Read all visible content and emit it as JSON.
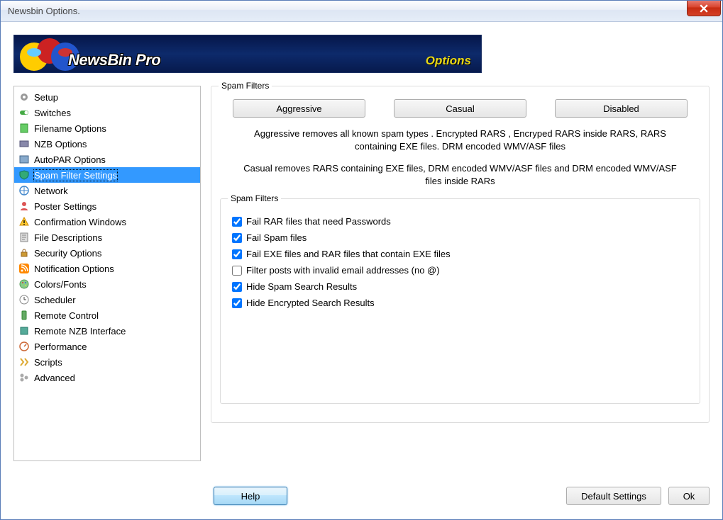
{
  "window": {
    "title": "Newsbin Options."
  },
  "banner": {
    "brand": "NewsBin Pro",
    "right": "Options"
  },
  "sidebar": {
    "items": [
      {
        "label": "Setup",
        "icon": "gear-icon"
      },
      {
        "label": "Switches",
        "icon": "switch-icon"
      },
      {
        "label": "Filename Options",
        "icon": "filename-icon"
      },
      {
        "label": "NZB Options",
        "icon": "nzb-icon"
      },
      {
        "label": "AutoPAR Options",
        "icon": "autopar-icon"
      },
      {
        "label": "Spam Filter Settings",
        "icon": "shield-icon",
        "selected": true
      },
      {
        "label": "Network",
        "icon": "network-icon"
      },
      {
        "label": "Poster Settings",
        "icon": "poster-icon"
      },
      {
        "label": "Confirmation Windows",
        "icon": "warning-icon"
      },
      {
        "label": "File Descriptions",
        "icon": "file-icon"
      },
      {
        "label": "Security Options",
        "icon": "lock-icon"
      },
      {
        "label": "Notification Options",
        "icon": "rss-icon"
      },
      {
        "label": "Colors/Fonts",
        "icon": "palette-icon"
      },
      {
        "label": "Scheduler",
        "icon": "clock-icon"
      },
      {
        "label": "Remote Control",
        "icon": "remote-icon"
      },
      {
        "label": "Remote NZB Interface",
        "icon": "remote-nzb-icon"
      },
      {
        "label": "Performance",
        "icon": "performance-icon"
      },
      {
        "label": "Scripts",
        "icon": "script-icon"
      },
      {
        "label": "Advanced",
        "icon": "advanced-icon"
      }
    ]
  },
  "main": {
    "group1_title": "Spam Filters",
    "presets": {
      "aggressive": "Aggressive",
      "casual": "Casual",
      "disabled": "Disabled"
    },
    "desc_aggressive": "Aggressive removes all known spam types . Encrypted RARS , Encryped RARS inside RARS, RARS containing EXE files. DRM encoded WMV/ASF files",
    "desc_casual": "Casual removes RARS containing EXE files, DRM encoded WMV/ASF files and DRM encoded WMV/ASF files inside RARs",
    "group2_title": "Spam Filters",
    "checks": [
      {
        "label": "Fail RAR files that need Passwords",
        "checked": true
      },
      {
        "label": "Fail Spam files",
        "checked": true
      },
      {
        "label": "Fail EXE files and RAR files that contain EXE files",
        "checked": true
      },
      {
        "label": "Filter posts with invalid email addresses (no @)",
        "checked": false
      },
      {
        "label": "Hide Spam Search Results",
        "checked": true
      },
      {
        "label": "Hide Encrypted Search Results",
        "checked": true
      }
    ]
  },
  "buttons": {
    "help": "Help",
    "defaults": "Default Settings",
    "ok": "Ok"
  }
}
